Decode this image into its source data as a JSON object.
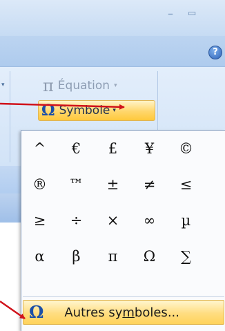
{
  "window": {
    "minimize_glyph": "–",
    "restore_glyph": "▭",
    "help_glyph": "?"
  },
  "ribbon": {
    "equation": {
      "icon_glyph": "π",
      "label": "Équation",
      "arrow": "▾"
    },
    "symbol": {
      "icon_glyph": "Ω",
      "label": "Symbole",
      "arrow": "▾"
    },
    "left_arrow": "▾"
  },
  "symbol_gallery": {
    "rows": [
      [
        "^",
        "€",
        "£",
        "¥",
        "©"
      ],
      [
        "®",
        "™",
        "±",
        "≠",
        "≤"
      ],
      [
        "≥",
        "÷",
        "×",
        "∞",
        "µ"
      ],
      [
        "α",
        "β",
        "π",
        "Ω",
        "∑"
      ]
    ]
  },
  "more_symbols": {
    "icon_glyph": "Ω",
    "label_pre": "Autres sy",
    "label_mnemonic": "m",
    "label_post": "boles..."
  },
  "colors": {
    "highlight_top": "#fff4c8",
    "highlight_bottom": "#ffc93c",
    "callout_arrow": "#d0121b",
    "symbol_icon": "#1b4fa8"
  }
}
